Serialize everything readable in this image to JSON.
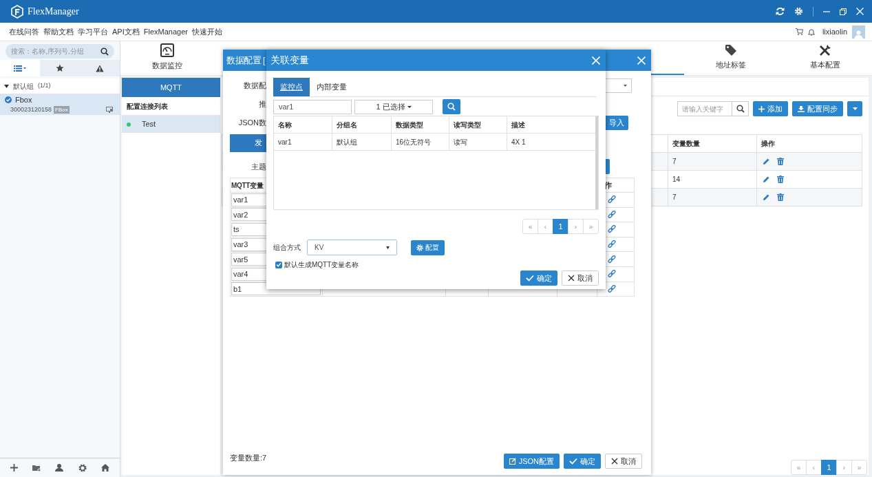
{
  "app": {
    "title": "FlexManager"
  },
  "menu": [
    "在线问答",
    "帮助文档",
    "学习平台",
    "API文档",
    "FlexManager",
    "快速开始"
  ],
  "user": {
    "name": "lixiaolin"
  },
  "sidebar": {
    "search": {
      "placeholder": "搜索：名称,序列号,分组"
    },
    "view_tabs": [
      {
        "kind": "list",
        "selected": true
      },
      {
        "kind": "star",
        "selected": false
      },
      {
        "kind": "alert",
        "selected": false
      }
    ],
    "tree": [
      {
        "label": "默认组",
        "count": "(1/1)",
        "expanded": true,
        "children": [
          {
            "label": "Fbox",
            "serial": "300023120158",
            "tag": "FBox",
            "checked": true,
            "selected": true
          }
        ]
      }
    ]
  },
  "nav_tabs": [
    {
      "kind": "gauge",
      "label": "数据监控",
      "selected": false
    },
    {
      "selected": true
    },
    {
      "kind": "tag",
      "label": "地址标签",
      "selected": false
    },
    {
      "kind": "tools",
      "label": "基本配置",
      "selected": false
    }
  ],
  "connections": {
    "header": "MQTT",
    "title": "配置连接列表",
    "items": [
      {
        "name": "Test",
        "online": true,
        "selected": true
      }
    ]
  },
  "toolbar": {
    "search": {
      "placeholder": "请输入关键字"
    },
    "buttons": [
      {
        "kind": "add",
        "label": "添加"
      },
      {
        "kind": "sync",
        "label": "配置同步"
      },
      {
        "kind": "dropdown"
      }
    ]
  },
  "groups_table": {
    "columns": [
      "变量数量",
      "操作"
    ],
    "rows": [
      {
        "count": "7"
      },
      {
        "count": "14"
      },
      {
        "count": "7"
      }
    ]
  },
  "pager": {
    "first": "«",
    "prev": "‹",
    "pages": [
      {
        "label": "1",
        "selected": true
      }
    ],
    "next": "›",
    "last": "»"
  },
  "data_config_dialog": {
    "title": "数据配置 [",
    "labels": [
      "数据配",
      "推",
      "JSON数"
    ],
    "import_button": "导入",
    "publish_tab": "发",
    "topic_label": "主题",
    "columns": [
      "MQTT变量",
      "作"
    ],
    "variables": [
      "var1",
      "var2",
      "ts",
      "var3",
      "var5",
      "var4",
      "b1"
    ],
    "count": "变量数量:7",
    "buttons": [
      {
        "kind": "json",
        "label": "JSON配置"
      },
      {
        "kind": "ok",
        "label": "确定"
      },
      {
        "kind": "cancel",
        "label": "取消"
      }
    ]
  },
  "link_dialog": {
    "title": "关联变量",
    "tabs": [
      {
        "label": "监控点",
        "selected": true
      },
      {
        "label": "内部变量",
        "selected": false
      }
    ],
    "search": {
      "value": "var1"
    },
    "filter": "1 已选择",
    "columns": [
      "名称",
      "分组名",
      "数据类型",
      "读写类型",
      "描述"
    ],
    "rows": [
      [
        "var1",
        "默认组",
        "16位无符号",
        "读写",
        "4X 1"
      ]
    ],
    "pager": {
      "first": "«",
      "prev": "‹",
      "pages": [
        {
          "label": "1",
          "selected": true
        }
      ],
      "next": "›",
      "last": "»"
    },
    "combine": {
      "label": "组合方式",
      "value": "KV"
    },
    "config_button": "配置",
    "auto_name": {
      "label": "默认生成MQTT变量名称",
      "checked": true
    },
    "buttons": [
      {
        "kind": "ok",
        "label": "确定"
      },
      {
        "kind": "cancel",
        "label": "取消"
      }
    ]
  }
}
